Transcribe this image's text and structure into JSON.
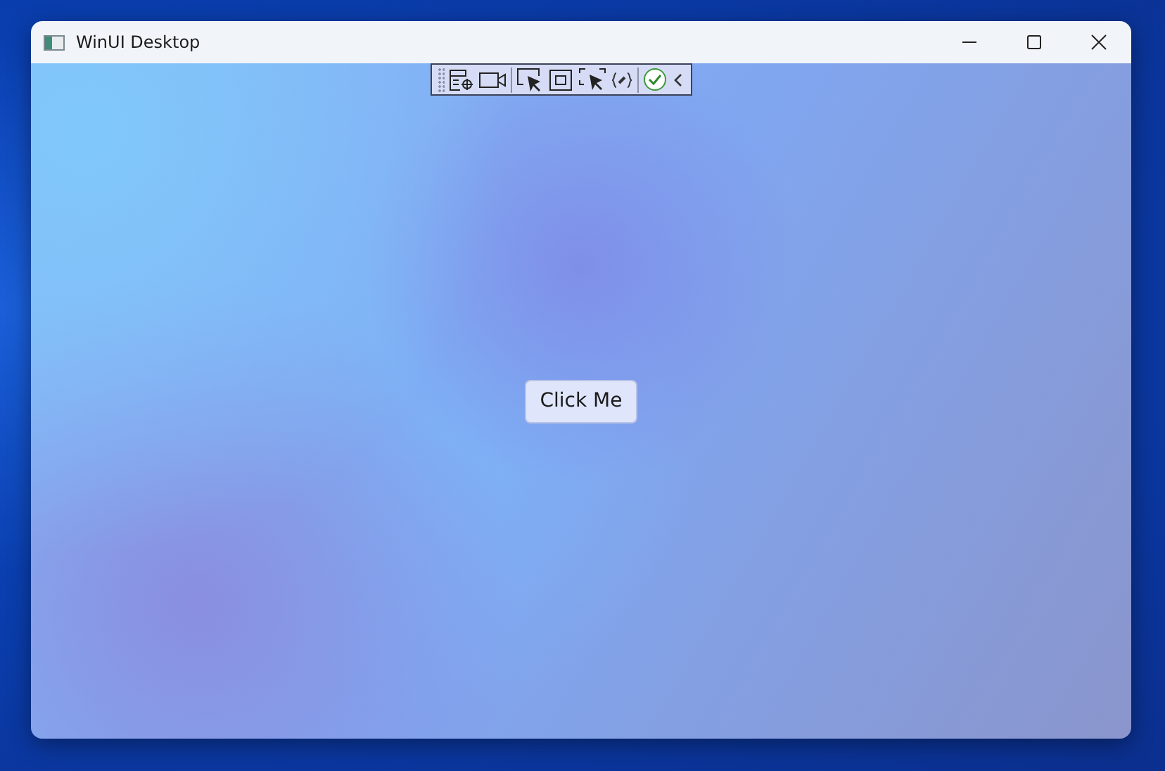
{
  "window": {
    "title": "WinUI Desktop"
  },
  "button": {
    "label": "Click Me"
  }
}
